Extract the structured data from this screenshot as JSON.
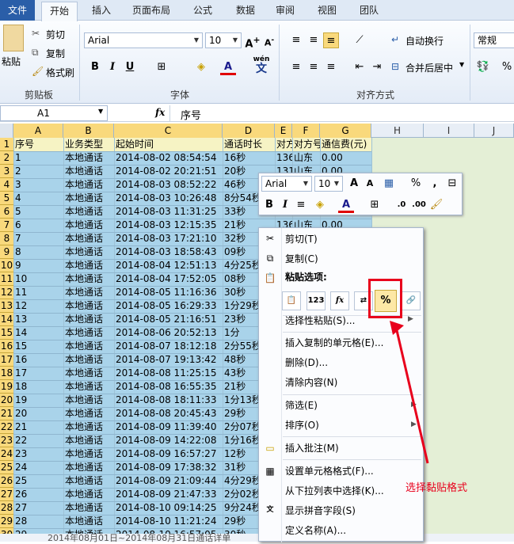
{
  "tabs": [
    "文件",
    "开始",
    "插入",
    "页面布局",
    "公式",
    "数据",
    "审阅",
    "视图",
    "团队"
  ],
  "clipboard": {
    "paste": "粘贴",
    "cut": "剪切",
    "copy": "复制",
    "format_painter": "格式刷",
    "label": "剪贴板"
  },
  "font": {
    "name": "Arial",
    "size": "10",
    "label": "字体",
    "wen": "wén",
    "wen_char": "文"
  },
  "alignment": {
    "wrap": "自动换行",
    "merge": "合并后居中",
    "label": "对齐方式"
  },
  "number": {
    "format": "常规",
    "percent": "%"
  },
  "formula_bar": {
    "cell_ref": "A1",
    "fx": "fx",
    "content": "序号"
  },
  "columns": [
    "A",
    "B",
    "C",
    "D",
    "E",
    "F",
    "G",
    "H",
    "I",
    "J"
  ],
  "rows": [
    "1",
    "2",
    "3",
    "4",
    "5",
    "6",
    "7",
    "8",
    "9",
    "10",
    "11",
    "12",
    "13",
    "14",
    "15",
    "16",
    "17",
    "18",
    "19",
    "20",
    "21",
    "22",
    "23",
    "24",
    "25",
    "26",
    "27",
    "28",
    "29",
    "30"
  ],
  "headers": [
    "序号",
    "业务类型",
    "起始时间",
    "通话时长",
    "对方号",
    "对方号",
    "通信费(元)"
  ],
  "records": [
    [
      "1",
      "本地通话",
      "2014-08-02 08:54:54",
      "16秒",
      "136",
      "山东",
      "0.00"
    ],
    [
      "2",
      "本地通话",
      "2014-08-02 20:21:51",
      "20秒",
      "131",
      "山东",
      "0.00"
    ],
    [
      "3",
      "本地通话",
      "2014-08-03 08:52:22",
      "46秒",
      "",
      "",
      ""
    ],
    [
      "4",
      "本地通话",
      "2014-08-03 10:26:48",
      "8分54秒",
      "",
      "",
      ""
    ],
    [
      "5",
      "本地通话",
      "2014-08-03 11:31:25",
      "33秒",
      "",
      "",
      ""
    ],
    [
      "6",
      "本地通话",
      "2014-08-03 12:15:35",
      "21秒",
      "136",
      "山东",
      "0.00"
    ],
    [
      "7",
      "本地通话",
      "2014-08-03 17:21:10",
      "32秒",
      "",
      "",
      ""
    ],
    [
      "8",
      "本地通话",
      "2014-08-03 18:58:43",
      "09秒",
      "",
      "",
      ""
    ],
    [
      "9",
      "本地通话",
      "2014-08-04 12:51:13",
      "4分25秒",
      "",
      "",
      ""
    ],
    [
      "10",
      "本地通话",
      "2014-08-04 17:52:05",
      "08秒",
      "",
      "",
      ""
    ],
    [
      "11",
      "本地通话",
      "2014-08-05 11:16:36",
      "30秒",
      "",
      "",
      ""
    ],
    [
      "12",
      "本地通话",
      "2014-08-05 16:29:33",
      "1分29秒",
      "",
      "",
      ""
    ],
    [
      "13",
      "本地通话",
      "2014-08-05 21:16:51",
      "23秒",
      "",
      "",
      ""
    ],
    [
      "14",
      "本地通话",
      "2014-08-06 20:52:13",
      "1分",
      "",
      "",
      ""
    ],
    [
      "15",
      "本地通话",
      "2014-08-07 18:12:18",
      "2分55秒",
      "",
      "",
      ""
    ],
    [
      "16",
      "本地通话",
      "2014-08-07 19:13:42",
      "48秒",
      "",
      "",
      ""
    ],
    [
      "17",
      "本地通话",
      "2014-08-08 11:25:15",
      "43秒",
      "",
      "",
      ""
    ],
    [
      "18",
      "本地通话",
      "2014-08-08 16:55:35",
      "21秒",
      "",
      "",
      ""
    ],
    [
      "19",
      "本地通话",
      "2014-08-08 18:11:33",
      "1分13秒",
      "",
      "",
      ""
    ],
    [
      "20",
      "本地通话",
      "2014-08-08 20:45:43",
      "29秒",
      "",
      "",
      ""
    ],
    [
      "21",
      "本地通话",
      "2014-08-09 11:39:40",
      "2分07秒",
      "",
      "",
      ""
    ],
    [
      "22",
      "本地通话",
      "2014-08-09 14:22:08",
      "1分16秒",
      "",
      "",
      ""
    ],
    [
      "23",
      "本地通话",
      "2014-08-09 16:57:27",
      "12秒",
      "",
      "",
      ""
    ],
    [
      "24",
      "本地通话",
      "2014-08-09 17:38:32",
      "31秒",
      "",
      "",
      ""
    ],
    [
      "25",
      "本地通话",
      "2014-08-09 21:09:44",
      "4分29秒",
      "",
      "",
      ""
    ],
    [
      "26",
      "本地通话",
      "2014-08-09 21:47:33",
      "2分02秒",
      "",
      "",
      ""
    ],
    [
      "27",
      "本地通话",
      "2014-08-10 09:14:25",
      "9分24秒",
      "",
      "",
      ""
    ],
    [
      "28",
      "本地通话",
      "2014-08-10 11:21:24",
      "29秒",
      "",
      "",
      ""
    ],
    [
      "29",
      "本地通话",
      "2014-08-10 16:57:05",
      "30秒",
      "",
      "",
      ""
    ]
  ],
  "sheet_tab": "2014年08月01日~2014年08月31日通话详单",
  "mini_toolbar": {
    "font": "Arial",
    "size": "10",
    "percent": "%",
    "comma": ","
  },
  "context_menu": {
    "cut": "剪切(T)",
    "copy": "复制(C)",
    "paste_options": "粘贴选项:",
    "paste_special": "选择性粘贴(S)...",
    "insert_copied": "插入复制的单元格(E)...",
    "delete": "删除(D)...",
    "clear": "清除内容(N)",
    "filter": "筛选(E)",
    "sort": "排序(O)",
    "insert_comment": "插入批注(M)",
    "format_cells": "设置单元格格式(F)...",
    "pick_list": "从下拉列表中选择(K)...",
    "phonetic": "显示拼音字段(S)",
    "define_name": "定义名称(A)..."
  },
  "annotation": "选择黏贴格式",
  "colors": {
    "selection": "#a9d3ea",
    "header_highlight": "#f9d97c",
    "accent_red": "#e8001c"
  }
}
